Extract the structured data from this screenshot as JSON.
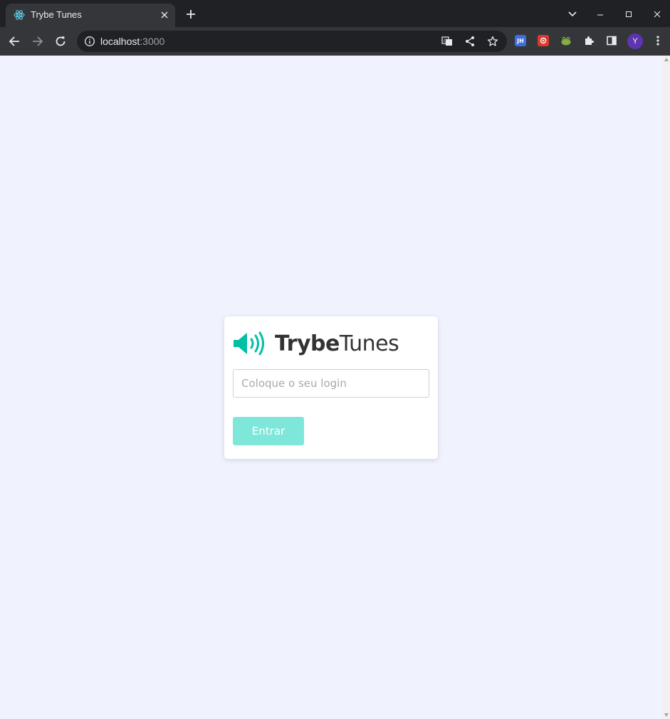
{
  "browser": {
    "tab": {
      "title": "Trybe Tunes"
    },
    "address_bar": {
      "host": "localhost",
      "port": ":3000"
    },
    "profile_initial": "Y",
    "extensions": [
      "JH",
      "red-extension",
      "frog-extension"
    ]
  },
  "login": {
    "logo": {
      "bold": "Trybe",
      "light": "Tunes",
      "accent_color": "#00bfa5"
    },
    "input": {
      "placeholder": "Coloque o seu login",
      "value": ""
    },
    "button": {
      "label": "Entrar",
      "color": "#7fe7d9",
      "disabled": true
    }
  }
}
